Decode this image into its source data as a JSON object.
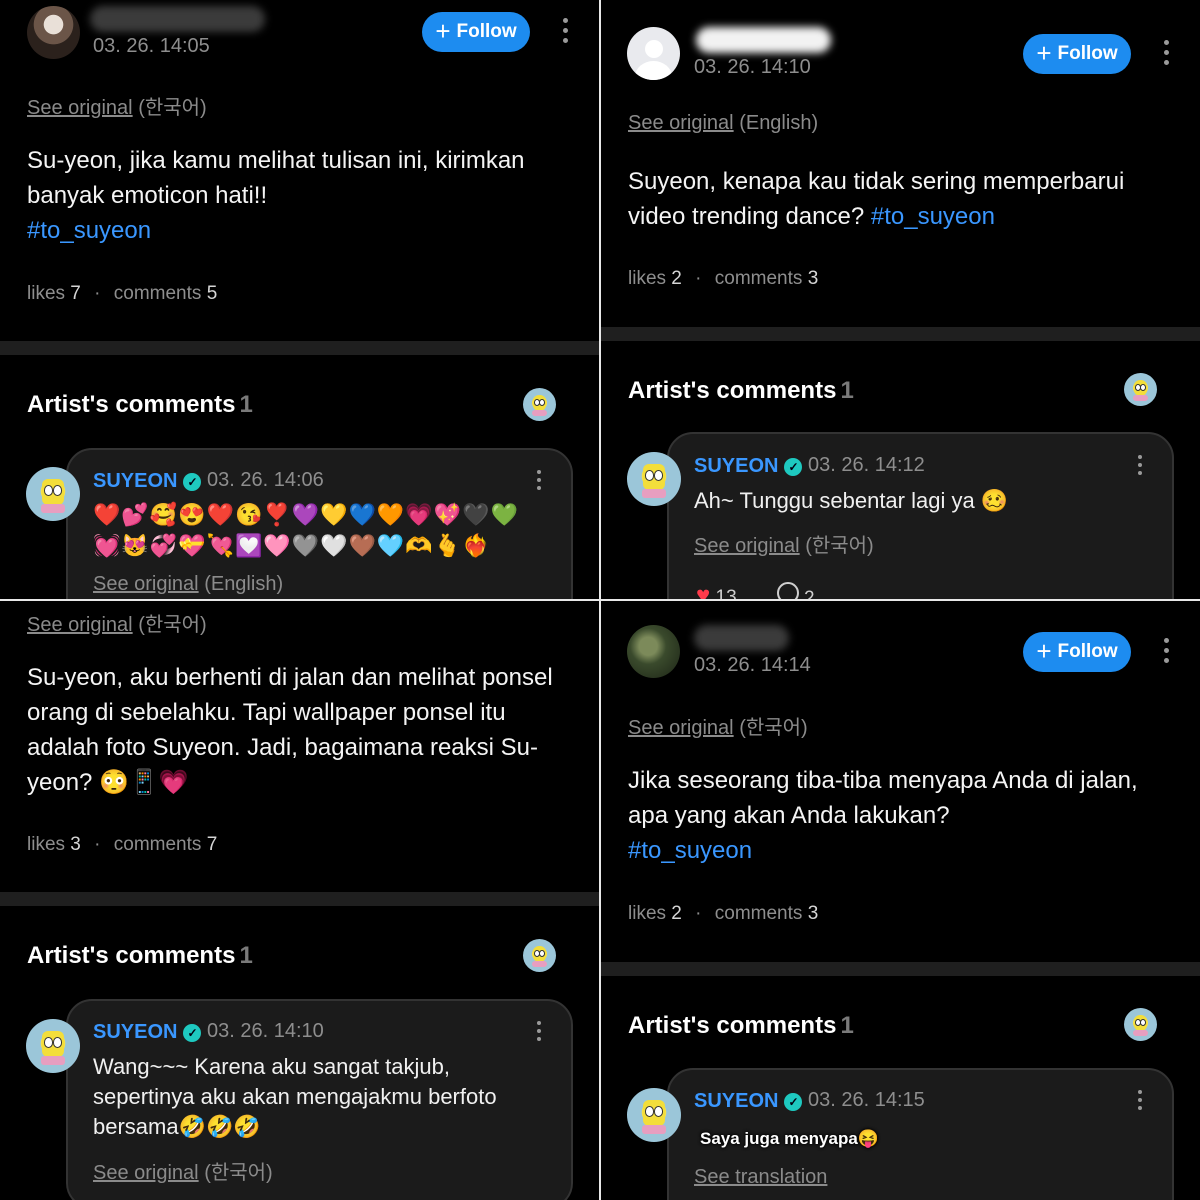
{
  "follow_label": "Follow",
  "colors": {
    "accent": "#1d8cf0",
    "hashtag": "#3a97ff",
    "background": "#000000",
    "verified": "#1ec9c0"
  },
  "icons": {
    "kebab": "more-vertical-icon",
    "plus": "plus-icon",
    "verified": "verified-badge-icon",
    "heart": "heart-icon",
    "comment": "comment-icon"
  },
  "panel1": {
    "timestamp": "03. 26. 14:05",
    "see_original": {
      "link": "See original",
      "lang": "(한국어)"
    },
    "body": "Su-yeon, jika kamu melihat tulisan ini, kirimkan banyak emoticon hati!!",
    "hashtag": "#to_suyeon",
    "likes_label": "likes",
    "likes": "7",
    "comments_label": "comments",
    "comments": "5",
    "artist_comments_title": "Artist's comments",
    "artist_comments_count": "1",
    "comment": {
      "name": "SUYEON",
      "timestamp": "03. 26. 14:06",
      "emoji_line1": "❤️💕🥰😍❤️😘❣️💜💛💙🧡💗💖🖤💚",
      "emoji_line2": "💓😻💞💝💘💟🩷🩶🤍🤎🩵🫶🫰❤️‍🔥",
      "see_original": {
        "link": "See original",
        "lang": "(English)"
      }
    }
  },
  "panel2": {
    "timestamp": "03. 26. 14:10",
    "see_original": {
      "link": "See original",
      "lang": "(English)"
    },
    "body": "Suyeon, kenapa kau tidak sering memperbarui video trending dance?",
    "hashtag": "#to_suyeon",
    "likes_label": "likes",
    "likes": "2",
    "comments_label": "comments",
    "comments": "3",
    "artist_comments_title": "Artist's comments",
    "artist_comments_count": "1",
    "comment": {
      "name": "SUYEON",
      "timestamp": "03. 26. 14:12",
      "text": "Ah~ Tunggu sebentar lagi ya 🥴",
      "see_original": {
        "link": "See original",
        "lang": "(한국어)"
      },
      "heart_count": "13",
      "reply_count": "2"
    }
  },
  "panel3": {
    "see_original": {
      "link": "See original",
      "lang": "(한국어)"
    },
    "body": "Su-yeon, aku berhenti di jalan dan melihat ponsel orang di sebelahku. Tapi wallpaper ponsel itu adalah foto Suyeon. Jadi, bagaimana reaksi Su-yeon? 😳📱💗",
    "likes_label": "likes",
    "likes": "3",
    "comments_label": "comments",
    "comments": "7",
    "artist_comments_title": "Artist's comments",
    "artist_comments_count": "1",
    "comment": {
      "name": "SUYEON",
      "timestamp": "03. 26. 14:10",
      "text": "Wang~~~ Karena aku sangat takjub, sepertinya aku akan mengajakmu berfoto bersama🤣🤣🤣",
      "see_original": {
        "link": "See original",
        "lang": "(한국어)"
      }
    }
  },
  "panel4": {
    "timestamp": "03. 26. 14:14",
    "see_original": {
      "link": "See original",
      "lang": "(한국어)"
    },
    "body": "Jika seseorang tiba-tiba menyapa Anda di jalan, apa yang akan Anda lakukan?",
    "hashtag": "#to_suyeon",
    "likes_label": "likes",
    "likes": "2",
    "comments_label": "comments",
    "comments": "3",
    "artist_comments_title": "Artist's comments",
    "artist_comments_count": "1",
    "comment": {
      "name": "SUYEON",
      "timestamp": "03. 26. 14:15",
      "sticker_text": "Saya juga menyapa😝",
      "see_translation": "See translation"
    }
  }
}
